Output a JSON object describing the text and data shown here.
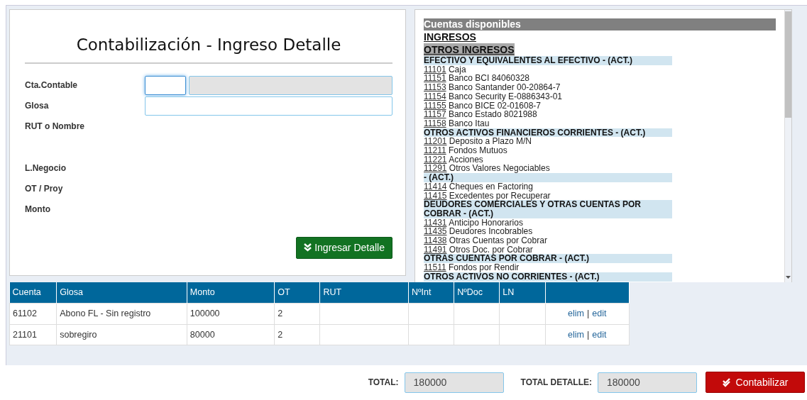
{
  "form": {
    "title": "Contabilización - Ingreso Detalle",
    "fields": [
      {
        "label": "Cta.Contable",
        "kind": "account"
      },
      {
        "label": "Glosa",
        "kind": "text"
      },
      {
        "label": "RUT o Nombre",
        "kind": "empty"
      },
      {
        "label": "L.Negocio",
        "kind": "empty"
      },
      {
        "label": "OT / Proy",
        "kind": "empty"
      },
      {
        "label": "Monto",
        "kind": "empty"
      }
    ],
    "account_code_focused": true,
    "account_name_disabled": true,
    "submit": "Ingresar Detalle"
  },
  "accounts": {
    "title": "Cuentas disponibles",
    "headings": [
      "INGRESOS",
      "OTROS INGRESOS"
    ],
    "groups": [
      {
        "name": "EFECTIVO Y EQUIVALENTES AL EFECTIVO - (ACT.)",
        "items": [
          {
            "code": "11101",
            "name": "Caja"
          },
          {
            "code": "11151",
            "name": "Banco BCI 84060328"
          },
          {
            "code": "11153",
            "name": "Banco Santander 00-20864-7"
          },
          {
            "code": "11154",
            "name": "Banco Security E-0886343-01"
          },
          {
            "code": "11155",
            "name": "Banco BICE 02-01608-7"
          },
          {
            "code": "11157",
            "name": "Banco Estado 8021988"
          },
          {
            "code": "11158",
            "name": "Banco Itau"
          }
        ]
      },
      {
        "name": "OTROS ACTIVOS FINANCIEROS CORRIENTES - (ACT.)",
        "items": [
          {
            "code": "11201",
            "name": "Deposito a Plazo M/N"
          },
          {
            "code": "11211",
            "name": "Fondos Mutuos"
          },
          {
            "code": "11221",
            "name": "Acciones"
          },
          {
            "code": "11291",
            "name": "Otros Valores Negociables"
          }
        ]
      },
      {
        "name": "- (ACT.)",
        "items": [
          {
            "code": "11414",
            "name": "Cheques en Factoring"
          },
          {
            "code": "11415",
            "name": "Excedentes por Recuperar"
          }
        ]
      },
      {
        "name": "DEUDORES COMERCIALES Y OTRAS CUENTAS POR COBRAR - (ACT.)",
        "items": [
          {
            "code": "11431",
            "name": "Anticipo Honorarios"
          },
          {
            "code": "11435",
            "name": "Deudores Incobrables"
          },
          {
            "code": "11438",
            "name": "Otras Cuentas por Cobrar"
          },
          {
            "code": "11491",
            "name": "Otros Doc. por Cobrar"
          }
        ]
      },
      {
        "name": "OTRAS CUENTAS POR COBRAR - (ACT.)",
        "items": [
          {
            "code": "11511",
            "name": "Fondos por Rendir"
          }
        ]
      },
      {
        "name": "OTROS ACTIVOS NO CORRIENTES - (ACT.)"
      }
    ]
  },
  "table": {
    "columns": [
      "Cuenta",
      "Glosa",
      "Monto",
      "OT",
      "RUT",
      "NºInt",
      "NºDoc",
      "LN"
    ],
    "rows": [
      {
        "cells": [
          "61102",
          "Abono FL - Sin registro",
          "100000",
          "2",
          "",
          "",
          "",
          ""
        ],
        "actions": [
          "elim",
          "|",
          "edit"
        ]
      },
      {
        "cells": [
          "21101",
          "sobregiro",
          "80000",
          "2",
          "",
          "",
          "",
          ""
        ],
        "actions": [
          "elim",
          "|",
          "edit"
        ]
      }
    ]
  },
  "footer": {
    "total_label": "TOTAL:",
    "total_value": "180000",
    "detail_label": "TOTAL DETALLE:",
    "detail_value": "180000",
    "submit": "Contabilizar"
  }
}
